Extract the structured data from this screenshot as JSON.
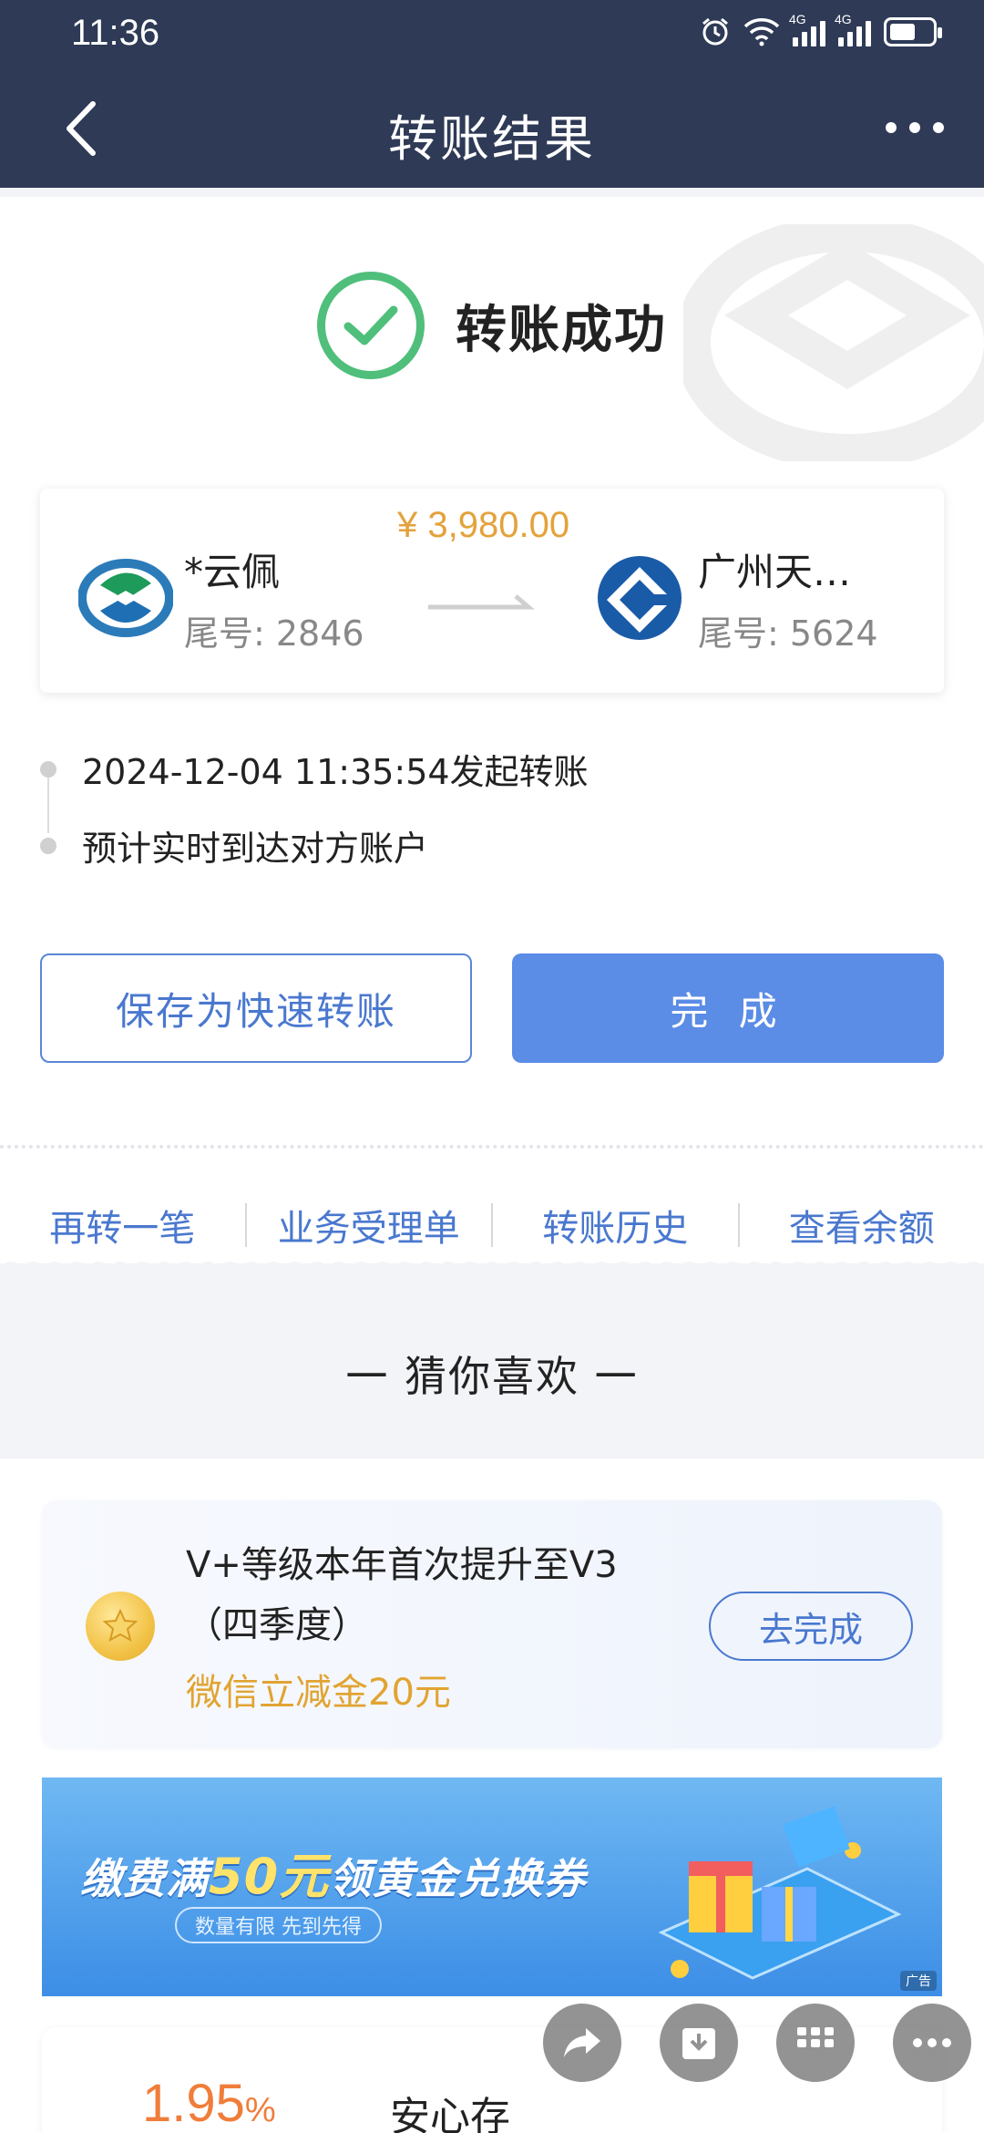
{
  "status_bar": {
    "time": "11:36",
    "net1": "4G",
    "net2": "4G"
  },
  "header": {
    "title": "转账结果"
  },
  "result": {
    "status_text": "转账成功"
  },
  "transfer": {
    "amount": "¥ 3,980.00",
    "from": {
      "name": "*云佩",
      "tail": "尾号: 2846"
    },
    "to": {
      "name": "广州天…",
      "tail": "尾号: 5624"
    }
  },
  "timeline": {
    "step1": "2024-12-04 11:35:54发起转账",
    "step2": "预计实时到达对方账户"
  },
  "buttons": {
    "save": "保存为快速转账",
    "done": "完 成"
  },
  "quick_links": [
    "再转一笔",
    "业务受理单",
    "转账历史",
    "查看余额"
  ],
  "recommend": {
    "section_title": "一 猜你喜欢 一",
    "card": {
      "title": "V+等级本年首次提升至V3（四季度）",
      "subtitle": "微信立减金20元",
      "button": "去完成"
    },
    "banner": {
      "title_a": "缴费满",
      "title_num": "50元",
      "title_b": "领黄金兑换券",
      "pill": "数量有限 先到先得",
      "ad": "广告"
    },
    "product": {
      "rate": "1.95",
      "rate_unit": "%",
      "name": "安心存"
    }
  },
  "colors": {
    "header": "#2e3a56",
    "accent": "#5b8ce6",
    "success": "#4fbf7b",
    "amount": "#e3a23b"
  }
}
